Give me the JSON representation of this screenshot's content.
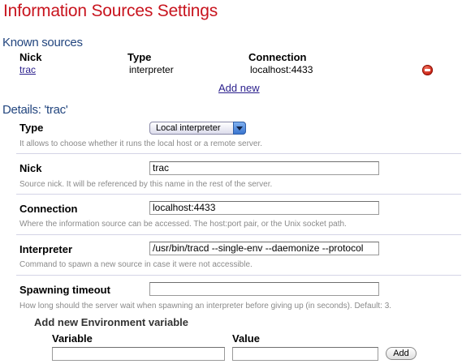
{
  "page": {
    "title": "Information Sources Settings"
  },
  "known_sources": {
    "title": "Known sources",
    "columns": {
      "nick": "Nick",
      "type": "Type",
      "connection": "Connection"
    },
    "rows": [
      {
        "nick": "trac",
        "type": "interpreter",
        "connection": "localhost:4433",
        "remove_icon": "minus-circle-icon"
      }
    ],
    "add_new_label": "Add new"
  },
  "details": {
    "title": "Details: 'trac'",
    "type": {
      "label": "Type",
      "selected": "Local interpreter",
      "help": "It allows to choose whether it runs the local host or a remote server."
    },
    "nick": {
      "label": "Nick",
      "value": "trac",
      "help": "Source nick. It will be referenced by this name in the rest of the server."
    },
    "connection": {
      "label": "Connection",
      "value": "localhost:4433",
      "help": "Where the information source can be accessed. The host:port pair, or the Unix socket path."
    },
    "interpreter": {
      "label": "Interpreter",
      "value": "/usr/bin/tracd --single-env --daemonize --protocol",
      "help": "Command to spawn a new source in case it were not accessible."
    },
    "spawning_timeout": {
      "label": "Spawning timeout",
      "value": "",
      "help": "How long should the server wait when spawning an interpreter before giving up (in seconds). Default: 3."
    }
  },
  "env": {
    "title": "Add new Environment variable",
    "variable_label": "Variable",
    "value_label": "Value",
    "variable_value": "",
    "value_value": "",
    "add_button": "Add"
  },
  "colors": {
    "title": "#c8141e",
    "section": "#23467f",
    "link": "#2a1f8c",
    "help": "#8a8a8a"
  }
}
